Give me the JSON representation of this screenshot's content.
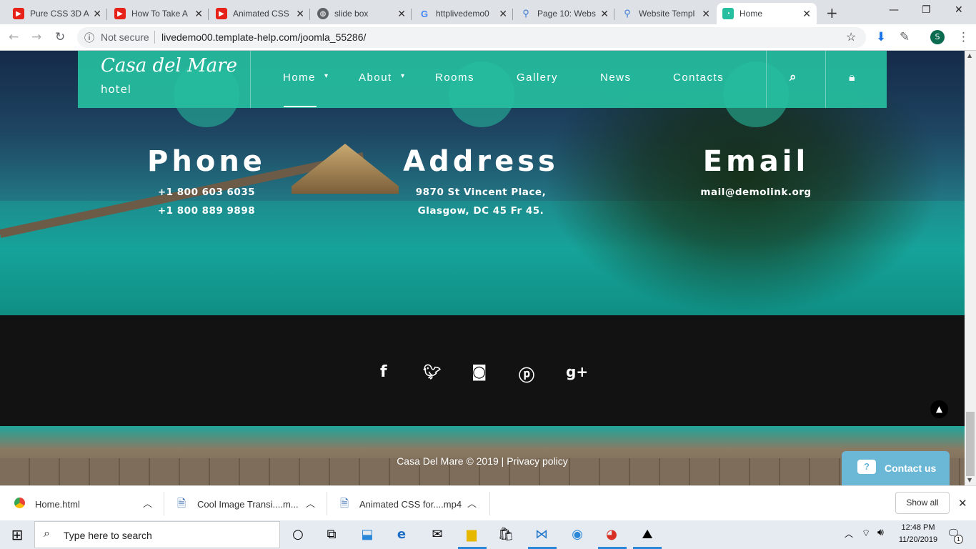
{
  "browser": {
    "tabs": [
      {
        "title": "Pure CSS 3D A",
        "icon": "youtube-icon"
      },
      {
        "title": "How To Take A",
        "icon": "youtube-icon"
      },
      {
        "title": "Animated CSS",
        "icon": "youtube-icon"
      },
      {
        "title": "slide box",
        "icon": "globe-icon"
      },
      {
        "title": "httplivedemo0",
        "icon": "google-icon"
      },
      {
        "title": "Page 10: Webs",
        "icon": "template-icon"
      },
      {
        "title": "Website Templ",
        "icon": "template-icon"
      },
      {
        "title": "Home",
        "icon": "site-icon",
        "active": true
      }
    ],
    "security_label": "Not secure",
    "url": "livedemo00.template-help.com/joomla_55286/",
    "profile_initial": "S"
  },
  "site": {
    "logo_script": "Casa del Mare",
    "logo_sub": "hotel",
    "nav": [
      "Home",
      "About",
      "Rooms",
      "Gallery",
      "News",
      "Contacts"
    ],
    "contact": {
      "phone_title": "Phone",
      "phone_lines": [
        "+1 800 603 6035",
        "+1 800 889 9898"
      ],
      "address_title": "Address",
      "address_lines": [
        "9870 St Vincent Place,",
        "Glasgow, DC 45 Fr 45."
      ],
      "email_title": "Email",
      "email_lines": [
        "mail@demolink.org"
      ]
    },
    "social": [
      "facebook-icon",
      "twitter-icon",
      "instagram-icon",
      "pinterest-icon",
      "google-plus-icon"
    ],
    "copyright": "Casa Del Mare © 2019 | Privacy policy",
    "contact_us": "Contact us",
    "accent_color": "#26bfa0"
  },
  "downloads": {
    "items": [
      "Home.html",
      "Cool Image Transi....m...",
      "Animated CSS for....mp4"
    ],
    "show_all": "Show all"
  },
  "taskbar": {
    "search_placeholder": "Type here to search",
    "time": "12:48 PM",
    "date": "11/20/2019",
    "notification_count": "1"
  }
}
